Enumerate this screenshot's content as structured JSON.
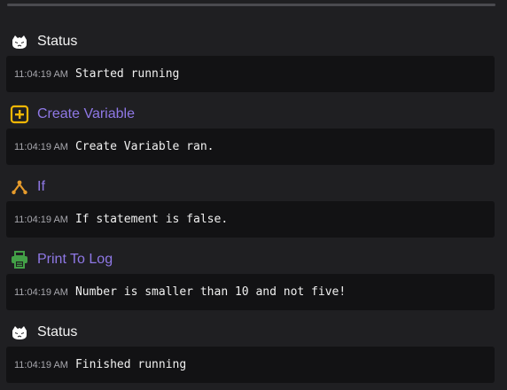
{
  "entries": [
    {
      "title": "Status",
      "icon": "ghost-icon",
      "type": "status",
      "timestamp": "11:04:19 AM",
      "message": "Started running"
    },
    {
      "title": "Create Variable",
      "icon": "plus-square-icon",
      "type": "action",
      "timestamp": "11:04:19 AM",
      "message": "Create Variable ran."
    },
    {
      "title": "If",
      "icon": "branch-icon",
      "type": "action",
      "timestamp": "11:04:19 AM",
      "message": "If statement is false."
    },
    {
      "title": "Print To Log",
      "icon": "printer-icon",
      "type": "action",
      "timestamp": "11:04:19 AM",
      "message": "Number is smaller than 10 and not five!"
    },
    {
      "title": "Status",
      "icon": "ghost-icon",
      "type": "status",
      "timestamp": "11:04:19 AM",
      "message": "Finished running"
    }
  ],
  "colors": {
    "background": "#1f1f22",
    "panel": "#121214",
    "action_title": "#8f78e6",
    "status_title": "#f2f2f2",
    "plus_icon": "#f2b705",
    "branch_icon": "#e69b2c",
    "printer_icon": "#43a047",
    "ghost_icon": "#ffffff"
  }
}
